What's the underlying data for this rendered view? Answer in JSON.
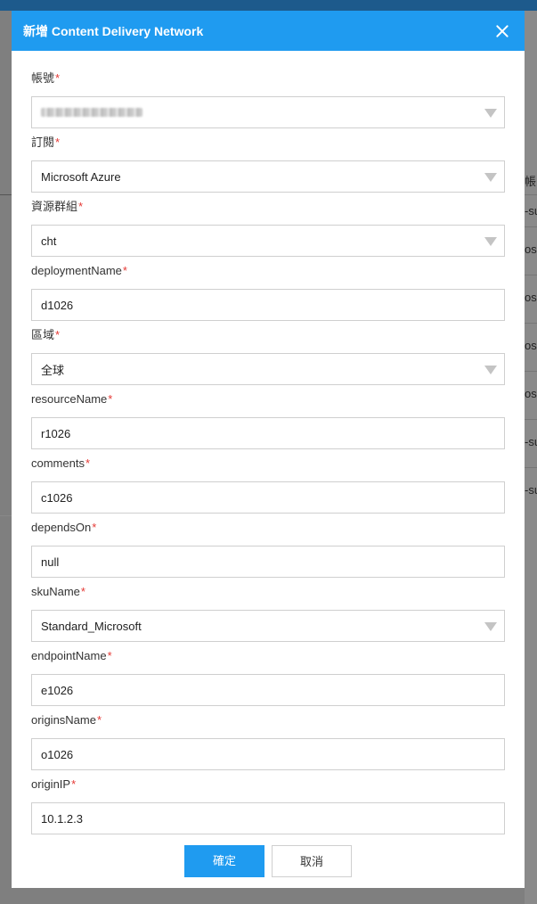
{
  "background": {
    "header_cell": "帳",
    "rows": [
      "-su",
      "osc",
      "osc",
      "osc",
      "osc",
      "-su",
      "-su"
    ]
  },
  "modal": {
    "title": "新增 Content Delivery Network",
    "fields": [
      {
        "label": "帳號",
        "type": "select",
        "value": ""
      },
      {
        "label": "訂閱",
        "type": "select",
        "value": "Microsoft Azure"
      },
      {
        "label": "資源群組",
        "type": "select",
        "value": "cht"
      },
      {
        "label": "deploymentName",
        "type": "input",
        "value": "d1026"
      },
      {
        "label": "區域",
        "type": "select",
        "value": "全球"
      },
      {
        "label": "resourceName",
        "type": "input",
        "value": "r1026"
      },
      {
        "label": "comments",
        "type": "input",
        "value": "c1026"
      },
      {
        "label": "dependsOn",
        "type": "input",
        "value": "null"
      },
      {
        "label": "skuName",
        "type": "select",
        "value": "Standard_Microsoft"
      },
      {
        "label": "endpointName",
        "type": "input",
        "value": "e1026"
      },
      {
        "label": "originsName",
        "type": "input",
        "value": "o1026"
      },
      {
        "label": "originIP",
        "type": "input",
        "value": "10.1.2.3"
      }
    ],
    "required_mark": "*",
    "ok_label": "確定",
    "cancel_label": "取消"
  }
}
